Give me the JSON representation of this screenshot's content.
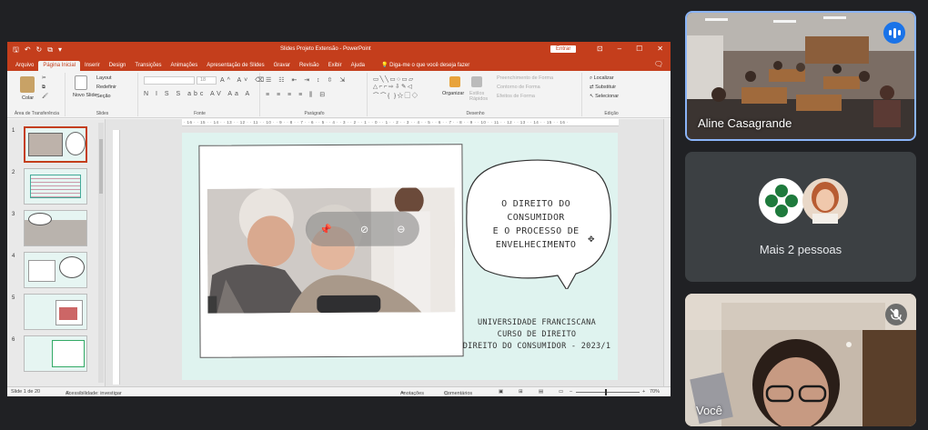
{
  "ppt": {
    "window_title": "Slides Projeto Extensão  -  PowerPoint",
    "signin_label": "Entrar",
    "tabs": [
      "Arquivo",
      "Página Inicial",
      "Inserir",
      "Design",
      "Transições",
      "Animações",
      "Apresentação de Slides",
      "Gravar",
      "Revisão",
      "Exibir",
      "Ajuda"
    ],
    "tell_me": "Diga-me o que você deseja fazer",
    "ribbon": {
      "paste_label": "Colar",
      "clipboard_group": "Área de Transferência",
      "new_slide_label": "Novo Slide",
      "layout_label": "Layout",
      "reset_label": "Redefinir",
      "section_label": "Seção",
      "slides_group": "Slides",
      "font_size": "18",
      "font_group": "Fonte",
      "paragraph_group": "Parágrafo",
      "arrange_label": "Organizar",
      "quick_styles_label": "Estilos Rápidos",
      "shape_fill": "Preenchimento de Forma",
      "shape_outline": "Contorno de Forma",
      "shape_effects": "Efeitos de Forma",
      "drawing_group": "Desenho",
      "find_label": "Localizar",
      "replace_label": "Substituir",
      "select_label": "Selecionar",
      "editing_group": "Edição"
    },
    "thumb_numbers": [
      "1",
      "2",
      "3",
      "4",
      "5",
      "6"
    ],
    "ruler_text": "· 16 · · 15 · · 14 · · 13 · · 12 · · 11 · · 10 · · 9 · · 8 · · 7 · · 6 · · 5 · · 4 · · 3 · · 2 · · 1 · · 0 · · 1 · · 2 · · 3 · · 4 · · 5 · · 6 · · 7 · · 8 · · 9 · · 10 · · 11 · · 12 · · 13 · · 14 · · 15 · · 16 ·",
    "slide": {
      "title_lines": [
        "O DIREITO DO",
        "CONSUMIDOR",
        "E O PROCESSO DE",
        "ENVELHECIMENTO"
      ],
      "footer_lines": [
        "UNIVERSIDADE FRANCISCANA",
        "CURSO DE DIREITO",
        "DIREITO DO CONSUMIDOR - 2023/1"
      ]
    },
    "status": {
      "slide_count": "Slide 1 de 20",
      "accessibility": "Acessibilidade: investigar",
      "notes": "Anotações",
      "comments": "Comentários",
      "zoom": "70%"
    }
  },
  "meet": {
    "tiles": [
      {
        "name": "Aline Casagrande"
      },
      {
        "name": "Mais 2 pessoas"
      },
      {
        "name": "Você"
      }
    ]
  },
  "colors": {
    "ppt_accent": "#c43e1c",
    "slide_bg": "#dff3ef",
    "meet_bg": "#202124",
    "active_speaker": "#8ab4f8"
  }
}
